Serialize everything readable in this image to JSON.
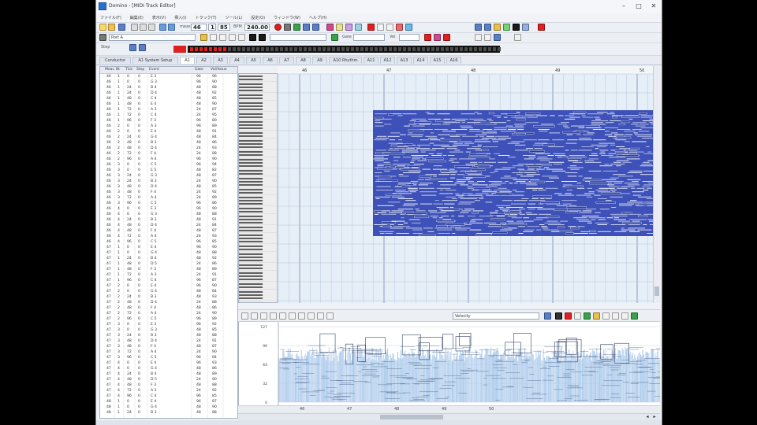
{
  "window": {
    "title": "Domino - [MIDI Track Editor]",
    "minimize": "–",
    "maximize": "□",
    "close": "✕"
  },
  "menu": [
    "ファイル(F)",
    "編集(E)",
    "表示(V)",
    "挿入(I)",
    "トラック(T)",
    "ツール(L)",
    "設定(O)",
    "ウィンドウ(W)",
    "ヘルプ(H)"
  ],
  "toolbar": {
    "measure": "46",
    "beat": "1",
    "tick": "85",
    "bpm_label": "BPM",
    "tempo": "240.00",
    "port": "Port A",
    "gate_label": "Gate",
    "vel_label": "Vel",
    "step_label": "Step"
  },
  "tabs": [
    "Conductor",
    "A1 System Setup",
    "A1",
    "A2",
    "A3",
    "A4",
    "A5",
    "A6",
    "A7",
    "A8",
    "A9",
    "A10 Rhythm",
    "A11",
    "A12",
    "A13",
    "A14",
    "A15",
    "A16"
  ],
  "active_tab": "A1",
  "eventlist": {
    "headers": [
      "Meas",
      "Bt",
      "Tick",
      "Step",
      "Event",
      "Gate",
      "Vel/Value"
    ],
    "rows": [
      [
        "46",
        "1",
        "0",
        "0",
        "E 3",
        "96",
        "96"
      ],
      [
        "46",
        "1",
        "0",
        "0",
        "G 3",
        "96",
        "90"
      ],
      [
        "46",
        "1",
        "24",
        "0",
        "B 4",
        "48",
        "88"
      ],
      [
        "46",
        "1",
        "24",
        "0",
        "D 4",
        "48",
        "92"
      ],
      [
        "46",
        "1",
        "48",
        "0",
        "C 4",
        "48",
        "85"
      ],
      [
        "46",
        "1",
        "48",
        "0",
        "E 4",
        "48",
        "90"
      ],
      [
        "46",
        "1",
        "72",
        "0",
        "A 3",
        "24",
        "87"
      ],
      [
        "46",
        "1",
        "72",
        "0",
        "C 4",
        "24",
        "95"
      ],
      [
        "46",
        "1",
        "96",
        "0",
        "F 3",
        "96",
        "80"
      ],
      [
        "46",
        "2",
        "0",
        "0",
        "A 3",
        "96",
        "89"
      ],
      [
        "46",
        "2",
        "0",
        "0",
        "E 4",
        "48",
        "91"
      ],
      [
        "46",
        "2",
        "24",
        "0",
        "G 4",
        "48",
        "84"
      ],
      [
        "46",
        "2",
        "48",
        "0",
        "B 3",
        "48",
        "86"
      ],
      [
        "46",
        "2",
        "48",
        "0",
        "D 4",
        "24",
        "93"
      ],
      [
        "46",
        "2",
        "72",
        "0",
        "F 4",
        "24",
        "88"
      ],
      [
        "46",
        "2",
        "96",
        "0",
        "A 4",
        "96",
        "90"
      ],
      [
        "46",
        "3",
        "0",
        "0",
        "C 5",
        "96",
        "94"
      ],
      [
        "46",
        "3",
        "0",
        "0",
        "E 5",
        "48",
        "82"
      ],
      [
        "46",
        "3",
        "24",
        "0",
        "G 3",
        "48",
        "87"
      ],
      [
        "46",
        "3",
        "24",
        "0",
        "B 3",
        "24",
        "90"
      ],
      [
        "46",
        "3",
        "48",
        "0",
        "D 4",
        "48",
        "85"
      ],
      [
        "46",
        "3",
        "48",
        "0",
        "F 4",
        "24",
        "92"
      ],
      [
        "46",
        "3",
        "72",
        "0",
        "A 4",
        "24",
        "89"
      ],
      [
        "46",
        "3",
        "96",
        "0",
        "C 5",
        "96",
        "86"
      ],
      [
        "46",
        "4",
        "0",
        "0",
        "E 3",
        "96",
        "90"
      ],
      [
        "46",
        "4",
        "0",
        "0",
        "G 3",
        "48",
        "88"
      ],
      [
        "46",
        "4",
        "24",
        "0",
        "B 3",
        "48",
        "91"
      ],
      [
        "46",
        "4",
        "48",
        "0",
        "D 4",
        "24",
        "84"
      ],
      [
        "46",
        "4",
        "48",
        "0",
        "F 4",
        "48",
        "87"
      ],
      [
        "46",
        "4",
        "72",
        "0",
        "A 4",
        "24",
        "93"
      ],
      [
        "46",
        "4",
        "96",
        "0",
        "C 5",
        "96",
        "85"
      ],
      [
        "47",
        "1",
        "0",
        "0",
        "E 4",
        "96",
        "90"
      ],
      [
        "47",
        "1",
        "0",
        "0",
        "G 4",
        "48",
        "88"
      ],
      [
        "47",
        "1",
        "24",
        "0",
        "B 4",
        "48",
        "92"
      ],
      [
        "47",
        "1",
        "48",
        "0",
        "D 5",
        "24",
        "86"
      ],
      [
        "47",
        "1",
        "48",
        "0",
        "F 3",
        "48",
        "89"
      ],
      [
        "47",
        "1",
        "72",
        "0",
        "A 3",
        "24",
        "91"
      ],
      [
        "47",
        "1",
        "96",
        "0",
        "C 4",
        "96",
        "87"
      ],
      [
        "47",
        "2",
        "0",
        "0",
        "E 4",
        "96",
        "90"
      ],
      [
        "47",
        "2",
        "0",
        "0",
        "G 4",
        "48",
        "84"
      ],
      [
        "47",
        "2",
        "24",
        "0",
        "B 3",
        "48",
        "93"
      ],
      [
        "47",
        "2",
        "48",
        "0",
        "D 4",
        "24",
        "88"
      ],
      [
        "47",
        "2",
        "48",
        "0",
        "F 4",
        "48",
        "86"
      ],
      [
        "47",
        "2",
        "72",
        "0",
        "A 4",
        "24",
        "90"
      ],
      [
        "47",
        "2",
        "96",
        "0",
        "C 5",
        "96",
        "89"
      ],
      [
        "47",
        "3",
        "0",
        "0",
        "E 3",
        "96",
        "92"
      ],
      [
        "47",
        "3",
        "0",
        "0",
        "G 3",
        "48",
        "85"
      ],
      [
        "47",
        "3",
        "24",
        "0",
        "B 3",
        "48",
        "88"
      ],
      [
        "47",
        "3",
        "48",
        "0",
        "D 4",
        "24",
        "91"
      ],
      [
        "47",
        "3",
        "48",
        "0",
        "F 4",
        "48",
        "87"
      ],
      [
        "47",
        "3",
        "72",
        "0",
        "A 4",
        "24",
        "90"
      ],
      [
        "47",
        "3",
        "96",
        "0",
        "C 5",
        "96",
        "84"
      ],
      [
        "47",
        "4",
        "0",
        "0",
        "E 4",
        "96",
        "93"
      ],
      [
        "47",
        "4",
        "0",
        "0",
        "G 4",
        "48",
        "86"
      ],
      [
        "47",
        "4",
        "24",
        "0",
        "B 4",
        "48",
        "89"
      ],
      [
        "47",
        "4",
        "48",
        "0",
        "D 5",
        "24",
        "90"
      ],
      [
        "47",
        "4",
        "48",
        "0",
        "F 3",
        "48",
        "88"
      ],
      [
        "47",
        "4",
        "72",
        "0",
        "A 3",
        "24",
        "92"
      ],
      [
        "47",
        "4",
        "96",
        "0",
        "C 4",
        "96",
        "85"
      ],
      [
        "48",
        "1",
        "0",
        "0",
        "E 4",
        "96",
        "87"
      ],
      [
        "48",
        "1",
        "0",
        "0",
        "G 4",
        "48",
        "90"
      ],
      [
        "48",
        "1",
        "24",
        "0",
        "B 3",
        "48",
        "88"
      ]
    ]
  },
  "ruler": [
    "46",
    "47",
    "48",
    "49",
    "50"
  ],
  "controller": {
    "selector": "Velocity",
    "scale": [
      "127",
      "96",
      "64",
      "32",
      "0"
    ]
  },
  "bottom_ruler": [
    "46",
    "47",
    "48",
    "49",
    "50"
  ],
  "colors": {
    "note": "#3d51b8",
    "roll_bg": "#e6eef7",
    "grid_major": "#7f95b3",
    "grid_minor": "#b8c8dc",
    "velocity_fill": "#a9c8ea",
    "accent_red": "#e02020"
  }
}
